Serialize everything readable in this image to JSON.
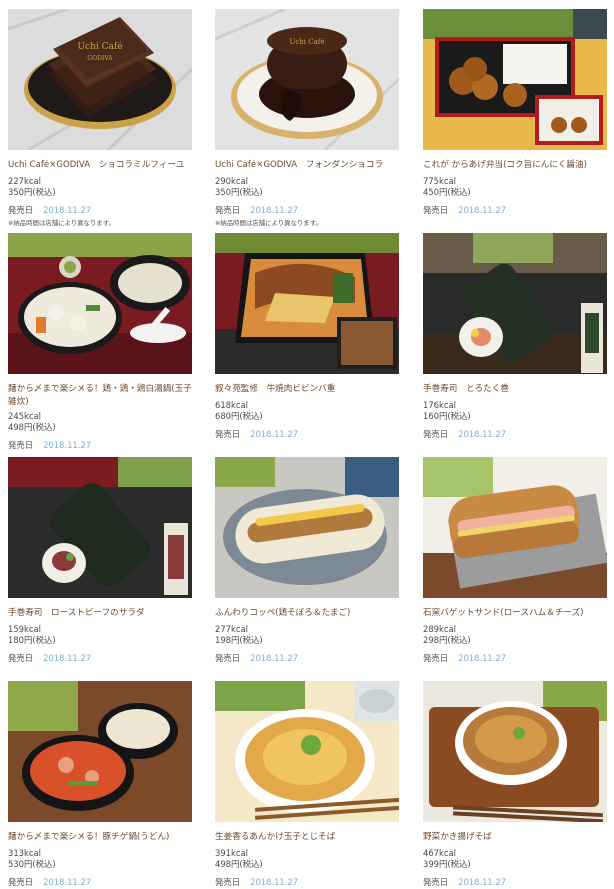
{
  "products": [
    {
      "name": "Uchi Café×GODIVA　ショコラミルフィーユ",
      "kcal": "227kcal",
      "price": "350円(税込)",
      "date_label": "発売日",
      "date": "2018.11.27",
      "note": "※納品時間は店舗により異なります。"
    },
    {
      "name": "Uchi Café×GODIVA　フォンダンショコラ",
      "kcal": "290kcal",
      "price": "350円(税込)",
      "date_label": "発売日",
      "date": "2018.11.27",
      "note": "※納品時間は店舗により異なります。"
    },
    {
      "name": "これが からあげ弁当(コク旨にんにく醤油)",
      "kcal": "775kcal",
      "price": "450円(税込)",
      "date_label": "発売日",
      "date": "2018.11.27"
    },
    {
      "name": "麺から〆まで楽シメる！鶏・鶏・鶏白湯鍋(玉子雑炊)",
      "kcal": "245kcal",
      "price": "498円(税込)",
      "date_label": "発売日",
      "date": "2018.11.27"
    },
    {
      "name": "叙々苑監修　牛焼肉ビビンバ重",
      "kcal": "618kcal",
      "price": "680円(税込)",
      "date_label": "発売日",
      "date": "2018.11.27"
    },
    {
      "name": "手巻寿司　とろたく巻",
      "kcal": "176kcal",
      "price": "160円(税込)",
      "date_label": "発売日",
      "date": "2018.11.27"
    },
    {
      "name": "手巻寿司　ローストビーフのサラダ",
      "kcal": "159kcal",
      "price": "180円(税込)",
      "date_label": "発売日",
      "date": "2018.11.27"
    },
    {
      "name": "ふんわりコッペ(鶏そぼろ＆たまご)",
      "kcal": "277kcal",
      "price": "198円(税込)",
      "date_label": "発売日",
      "date": "2018.11.27"
    },
    {
      "name": "石窯バゲットサンド(ロースハム＆チーズ)",
      "kcal": "289kcal",
      "price": "298円(税込)",
      "date_label": "発売日",
      "date": "2018.11.27"
    },
    {
      "name": "麺から〆まで楽シメる！豚チゲ鍋(うどん)",
      "kcal": "313kcal",
      "price": "530円(税込)",
      "date_label": "発売日",
      "date": "2018.11.27"
    },
    {
      "name": "生姜香るあんかけ玉子とじそば",
      "kcal": "391kcal",
      "price": "498円(税込)",
      "date_label": "発売日",
      "date": "2018.11.27"
    },
    {
      "name": "野菜かき揚げそば",
      "kcal": "467kcal",
      "price": "399円(税込)",
      "date_label": "発売日",
      "date": "2018.11.27"
    }
  ]
}
